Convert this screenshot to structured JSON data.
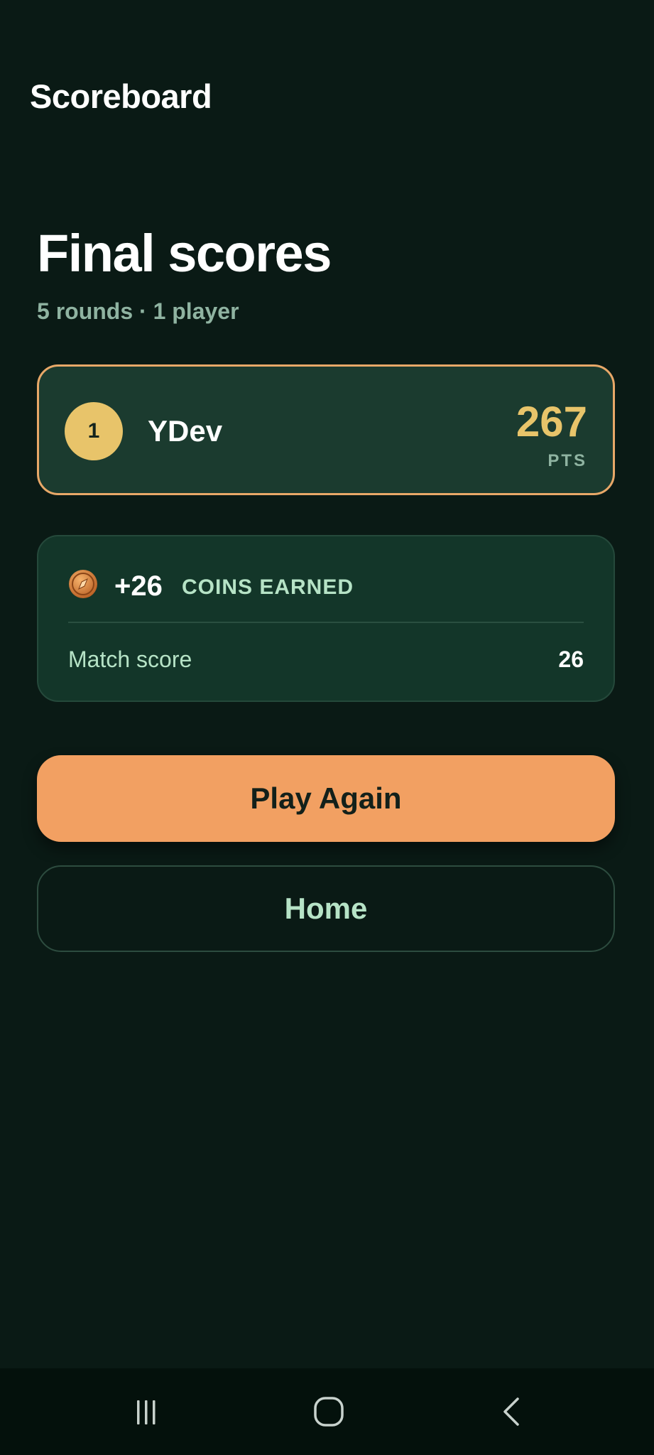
{
  "app": {
    "title": "Scoreboard"
  },
  "summary": {
    "heading": "Final scores",
    "subheading": "5 rounds · 1 player"
  },
  "players": [
    {
      "rank": "1",
      "name": "YDev",
      "score": "267",
      "score_unit": "PTS"
    }
  ],
  "coins": {
    "icon": "coin-icon",
    "amount": "+26",
    "label": "COINS EARNED",
    "match_score_label": "Match score",
    "match_score_value": "26"
  },
  "actions": {
    "play_again_label": "Play Again",
    "home_label": "Home"
  },
  "navigation": {
    "recents_icon": "recents-icon",
    "home_icon": "home-icon",
    "back_icon": "back-icon"
  },
  "colors": {
    "background": "#0a1a15",
    "accent": "#f2a062",
    "gold": "#e8c46a",
    "mint": "#b6e3c6",
    "muted": "#8fb3a1"
  }
}
